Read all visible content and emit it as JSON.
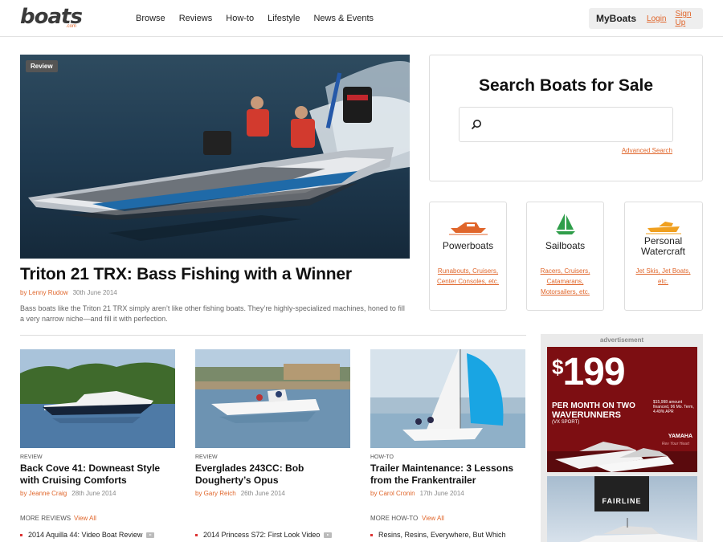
{
  "header": {
    "logo": "boats",
    "logo_sub": ".com",
    "nav": [
      "Browse",
      "Reviews",
      "How-to",
      "Lifestyle",
      "News & Events"
    ],
    "myboats": "MyBoats",
    "login": "Login",
    "signup": "Sign Up"
  },
  "hero": {
    "badge": "Review",
    "title": "Triton 21 TRX: Bass Fishing with a Winner",
    "by": "by Lenny Rudow",
    "date": "30th June 2014",
    "description": "Bass boats like the Triton 21 TRX simply aren’t like other fishing boats. They’re highly-specialized machines, honed to fill a very narrow niche—and fill it with perfection."
  },
  "search": {
    "title": "Search Boats for Sale",
    "placeholder": "",
    "advanced": "Advanced Search"
  },
  "categories": [
    {
      "title": "Powerboats",
      "links": "Runabouts, Cruisers, Center Consoles, etc.",
      "icon": "powerboat-icon",
      "color": "#e0662b"
    },
    {
      "title": "Sailboats",
      "links": "Racers, Cruisers, Catamarans, Motorsailers, etc.",
      "icon": "sailboat-icon",
      "color": "#2f9e4a"
    },
    {
      "title": "Personal Watercraft",
      "links": "Jet Skis, Jet Boats, etc.",
      "icon": "jetski-icon",
      "color": "#f0a020"
    }
  ],
  "ad": {
    "label": "advertisement",
    "price": "199",
    "dollar": "$",
    "line1": "PER MONTH ON TWO",
    "line2": "WAVERUNNERS",
    "fine": "$15,998 amount financed, 96 Mo. Term, 4.49% APR",
    "vx": "(VX SPORT)",
    "brand": "YAMAHA",
    "brand_tag": "Rev Your Heart",
    "fairline": "FAIRLINE"
  },
  "articles": [
    {
      "category": "REVIEW",
      "title": "Back Cove 41: Downeast Style with Cruising Comforts",
      "by": "by Jeanne Craig",
      "date": "28th June 2014"
    },
    {
      "category": "REVIEW",
      "title": "Everglades 243CC: Bob Dougherty’s Opus",
      "by": "by Gary Reich",
      "date": "26th June 2014"
    },
    {
      "category": "HOW-TO",
      "title": "Trailer Maintenance: 3 Lessons from the Frankentrailer",
      "by": "by Carol Cronin",
      "date": "17th June 2014"
    }
  ],
  "more": [
    {
      "label": "MORE REVIEWS",
      "view_all": "View All",
      "item": "2014 Aquilla 44: Video Boat Review"
    },
    {
      "label": "",
      "view_all": "",
      "item": "2014 Princess S72: First Look Video"
    },
    {
      "label": "MORE HOW-TO",
      "view_all": "View All",
      "item": "Resins, Resins, Everywhere, But Which"
    }
  ]
}
